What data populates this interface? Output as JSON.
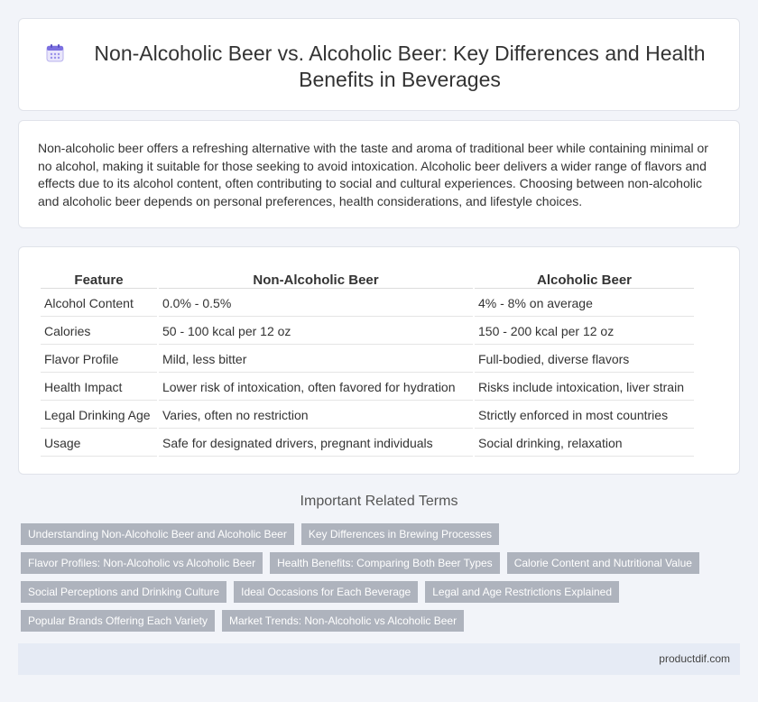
{
  "header": {
    "icon": "calendar-icon",
    "title": "Non-Alcoholic Beer vs. Alcoholic Beer: Key Differences and Health Benefits in Beverages"
  },
  "intro": {
    "text": "Non-alcoholic beer offers a refreshing alternative with the taste and aroma of traditional beer while containing minimal or no alcohol, making it suitable for those seeking to avoid intoxication. Alcoholic beer delivers a wider range of flavors and effects due to its alcohol content, often contributing to social and cultural experiences. Choosing between non-alcoholic and alcoholic beer depends on personal preferences, health considerations, and lifestyle choices."
  },
  "table": {
    "headers": [
      "Feature",
      "Non-Alcoholic Beer",
      "Alcoholic Beer"
    ],
    "rows": [
      [
        "Alcohol Content",
        "0.0% - 0.5%",
        "4% - 8% on average"
      ],
      [
        "Calories",
        "50 - 100 kcal per 12 oz",
        "150 - 200 kcal per 12 oz"
      ],
      [
        "Flavor Profile",
        "Mild, less bitter",
        "Full-bodied, diverse flavors"
      ],
      [
        "Health Impact",
        "Lower risk of intoxication, often favored for hydration",
        "Risks include intoxication, liver strain"
      ],
      [
        "Legal Drinking Age",
        "Varies, often no restriction",
        "Strictly enforced in most countries"
      ],
      [
        "Usage",
        "Safe for designated drivers, pregnant individuals",
        "Social drinking, relaxation"
      ]
    ]
  },
  "related": {
    "title": "Important Related Terms",
    "tags": [
      "Understanding Non-Alcoholic Beer and Alcoholic Beer",
      "Key Differences in Brewing Processes",
      "Flavor Profiles: Non-Alcoholic vs Alcoholic Beer",
      "Health Benefits: Comparing Both Beer Types",
      "Calorie Content and Nutritional Value",
      "Social Perceptions and Drinking Culture",
      "Ideal Occasions for Each Beverage",
      "Legal and Age Restrictions Explained",
      "Popular Brands Offering Each Variety",
      "Market Trends: Non-Alcoholic vs Alcoholic Beer"
    ]
  },
  "footer": {
    "site": "productdif.com"
  },
  "colors": {
    "page_bg": "#f2f4f9",
    "tag_bg": "#aeb3bd",
    "footer_bg": "#e6ebf5"
  }
}
